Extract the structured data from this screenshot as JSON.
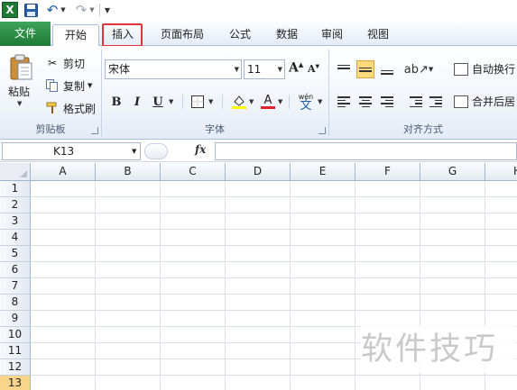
{
  "quick_access": {
    "app_icon": "X",
    "icons": [
      "excel-icon",
      "save-icon",
      "undo-icon",
      "redo-icon",
      "customize-icon"
    ]
  },
  "tabs": [
    {
      "key": "file",
      "label": "文件"
    },
    {
      "key": "home",
      "label": "开始"
    },
    {
      "key": "insert",
      "label": "插入"
    },
    {
      "key": "layout",
      "label": "页面布局"
    },
    {
      "key": "formula",
      "label": "公式"
    },
    {
      "key": "data",
      "label": "数据"
    },
    {
      "key": "review",
      "label": "审阅"
    },
    {
      "key": "view",
      "label": "视图"
    }
  ],
  "ribbon": {
    "clipboard": {
      "group_label": "剪贴板",
      "paste_label": "粘贴",
      "cut_label": "剪切",
      "copy_label": "复制",
      "format_painter_label": "格式刷"
    },
    "font": {
      "group_label": "字体",
      "font_name": "宋体",
      "font_size": "11",
      "bold_label": "B",
      "italic_label": "I",
      "underline_label": "U",
      "fontcolor_glyph": "A",
      "phonetic_glyph": "wén"
    },
    "alignment": {
      "group_label": "对齐方式",
      "wrap_label": "自动换行",
      "merge_label": "合并后居"
    }
  },
  "formula_bar": {
    "name_box": "K13",
    "fx_label": "fx",
    "formula": ""
  },
  "grid": {
    "columns": [
      "A",
      "B",
      "C",
      "D",
      "E",
      "F",
      "G",
      "H"
    ],
    "rows": [
      "1",
      "2",
      "3",
      "4",
      "5",
      "6",
      "7",
      "8",
      "9",
      "10",
      "11",
      "12",
      "13"
    ],
    "active_row": "13"
  },
  "watermark": "软件技巧",
  "colors": {
    "file_tab": "#1f7a35",
    "highlight_box": "#e0363a",
    "active_row_header": "#f9d58b",
    "align_selected": "#fcd97a"
  }
}
